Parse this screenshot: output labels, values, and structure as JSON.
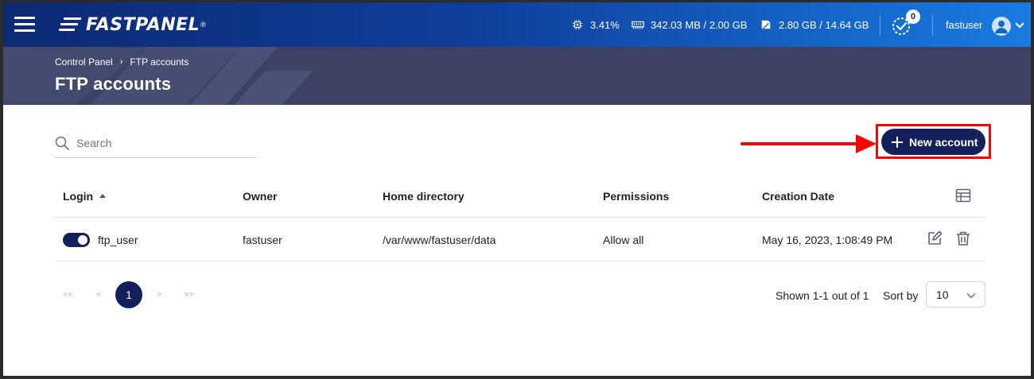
{
  "topbar": {
    "brand": "FASTPANEL",
    "brand_mark": "®",
    "cpu": "3.41%",
    "ram": "342.03 MB / 2.00 GB",
    "disk": "2.80 GB / 14.64 GB",
    "tasks_count": "0",
    "username": "fastuser"
  },
  "breadcrumb": {
    "root": "Control Panel",
    "current": "FTP accounts"
  },
  "page": {
    "title": "FTP accounts"
  },
  "search": {
    "placeholder": "Search"
  },
  "toolbar": {
    "new_account_label": "New account"
  },
  "table": {
    "headers": {
      "login": "Login",
      "owner": "Owner",
      "home": "Home directory",
      "permissions": "Permissions",
      "created": "Creation Date"
    },
    "rows": [
      {
        "enabled": true,
        "login": "ftp_user",
        "owner": "fastuser",
        "home": "/var/www/fastuser/data",
        "permissions": "Allow all",
        "created": "May 16, 2023, 1:08:49 PM"
      }
    ]
  },
  "pagination": {
    "first": "<<",
    "prev": "<",
    "current": "1",
    "next": ">",
    "last": ">>",
    "shown": "Shown 1-1 out of 1",
    "sort_label": "Sort by",
    "page_size": "10"
  },
  "colors": {
    "accent": "#14205c",
    "highlight": "#ff0000",
    "header_band": "#3d4166"
  }
}
